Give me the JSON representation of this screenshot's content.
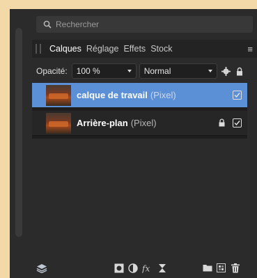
{
  "search": {
    "placeholder": "Rechercher"
  },
  "tabs": [
    {
      "label": "Calques",
      "active": true
    },
    {
      "label": "Réglage",
      "active": false
    },
    {
      "label": "Effets",
      "active": false
    },
    {
      "label": "Stock",
      "active": false
    }
  ],
  "opacity": {
    "label": "Opacité:",
    "value": "100 %"
  },
  "blend_mode": {
    "value": "Normal"
  },
  "layers": [
    {
      "name": "calque de travail",
      "type": "(Pixel)",
      "selected": true,
      "locked": false,
      "visible": true
    },
    {
      "name": "Arrière-plan",
      "type": "(Pixel)",
      "selected": false,
      "locked": true,
      "visible": true
    }
  ],
  "icons": {
    "search": "search-icon",
    "panel_menu": "hamburger-menu-icon",
    "settings": "gear-icon",
    "lock": "lock-icon",
    "footer": [
      "layers-stack-icon",
      "mask-icon",
      "adjustment-icon",
      "fx-icon",
      "live-filter-icon",
      "folder-icon",
      "pixel-layer-icon",
      "trash-icon"
    ]
  },
  "colors": {
    "selected_row": "#5b8fd6",
    "panel_bg": "#2b2b2b",
    "surround": "#f3d8a8"
  }
}
